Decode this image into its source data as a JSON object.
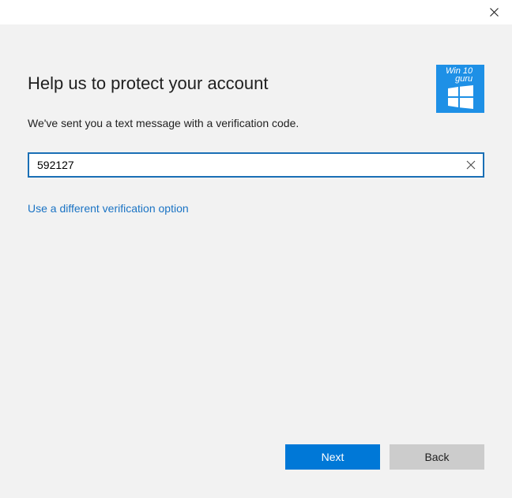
{
  "window": {
    "close_icon": "close-icon"
  },
  "header": {
    "title": "Help us to protect your account",
    "subtitle": "We've sent you a text message with a verification code."
  },
  "logo": {
    "text_line1": "Win 10",
    "text_line2": "guru",
    "icon": "windows-logo-icon",
    "background_color": "#1e90e6"
  },
  "code_field": {
    "value": "592127",
    "clear_icon": "clear-icon",
    "border_color": "#1a6fb5"
  },
  "alt_option_link": "Use a different verification option",
  "buttons": {
    "next_label": "Next",
    "back_label": "Back",
    "accent_color": "#0078d7"
  }
}
